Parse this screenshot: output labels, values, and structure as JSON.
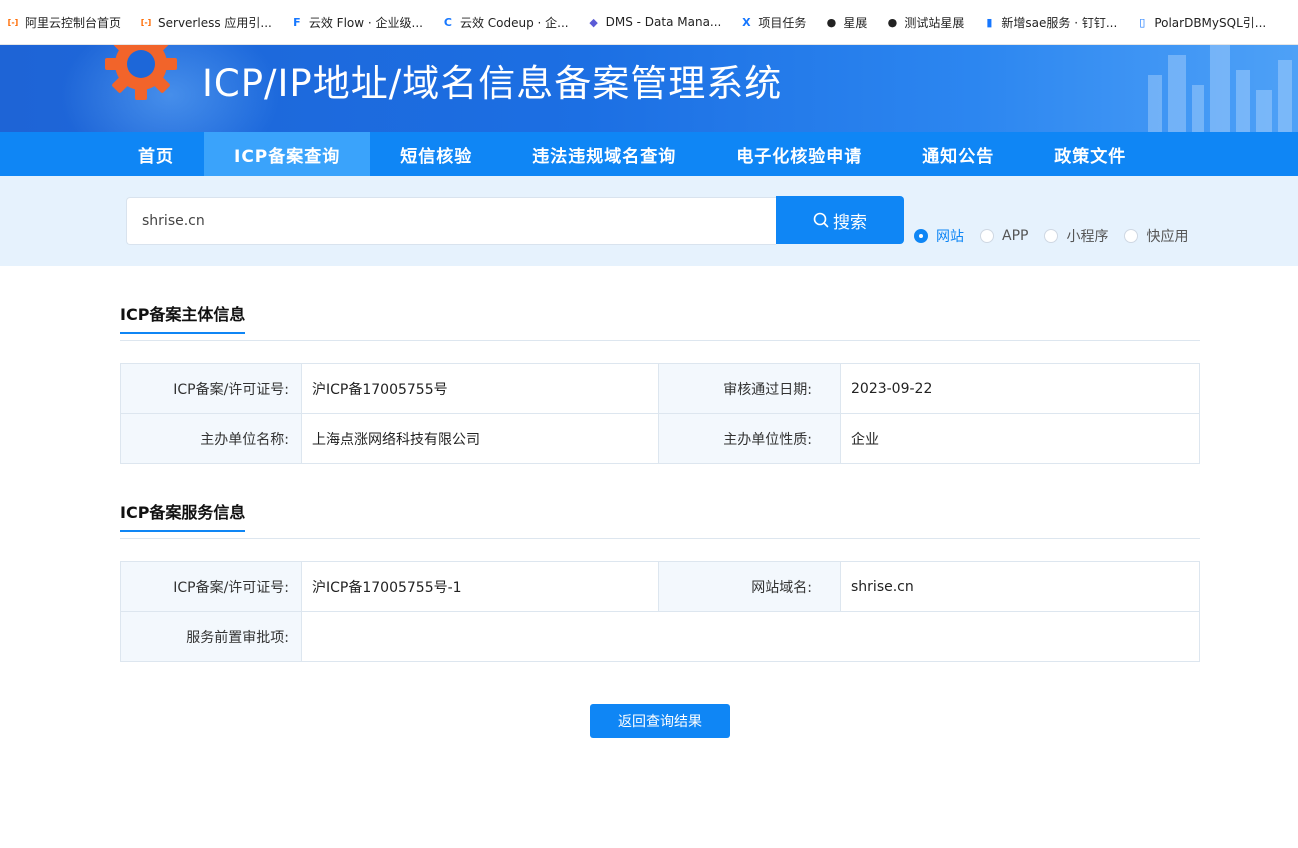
{
  "bookmarks": [
    {
      "label": "阿里云控制台首页",
      "icon": "aliyun-icon",
      "color": "#ff6a00"
    },
    {
      "label": "Serverless 应用引...",
      "icon": "aliyun-icon",
      "color": "#ff6a00"
    },
    {
      "label": "云效 Flow · 企业级...",
      "icon": "flow-icon",
      "color": "#1677ff"
    },
    {
      "label": "云效 Codeup · 企...",
      "icon": "codeup-icon",
      "color": "#1677ff"
    },
    {
      "label": "DMS - Data Mana...",
      "icon": "dms-icon",
      "color": "#5b5bd6"
    },
    {
      "label": "项目任务",
      "icon": "x-icon",
      "color": "#1677ff"
    },
    {
      "label": "星展",
      "icon": "github-icon",
      "color": "#222222"
    },
    {
      "label": "测试站星展",
      "icon": "github-icon",
      "color": "#222222"
    },
    {
      "label": "新增sae服务 · 钉钉...",
      "icon": "doc-icon",
      "color": "#1677ff"
    },
    {
      "label": "PolarDBMySQL引...",
      "icon": "book-icon",
      "color": "#1677ff"
    }
  ],
  "banner": {
    "title": "ICP/IP地址/域名信息备案管理系统"
  },
  "nav": [
    {
      "label": "首页",
      "active": false
    },
    {
      "label": "ICP备案查询",
      "active": true
    },
    {
      "label": "短信核验",
      "active": false
    },
    {
      "label": "违法违规域名查询",
      "active": false
    },
    {
      "label": "电子化核验申请",
      "active": false
    },
    {
      "label": "通知公告",
      "active": false
    },
    {
      "label": "政策文件",
      "active": false
    }
  ],
  "search": {
    "value": "shrise.cn",
    "button_label": "搜索",
    "types": [
      {
        "label": "网站",
        "selected": true
      },
      {
        "label": "APP",
        "selected": false
      },
      {
        "label": "小程序",
        "selected": false
      },
      {
        "label": "快应用",
        "selected": false
      }
    ]
  },
  "subject": {
    "title": "ICP备案主体信息",
    "rows": [
      {
        "k1": "ICP备案/许可证号:",
        "v1": "沪ICP备17005755号",
        "k2": "审核通过日期:",
        "v2": "2023-09-22"
      },
      {
        "k1": "主办单位名称:",
        "v1": "上海点涨网络科技有限公司",
        "k2": "主办单位性质:",
        "v2": "企业"
      }
    ]
  },
  "service": {
    "title": "ICP备案服务信息",
    "row1": {
      "k1": "ICP备案/许可证号:",
      "v1": "沪ICP备17005755号-1",
      "k2": "网站域名:",
      "v2": "shrise.cn"
    },
    "row2": {
      "k1": "服务前置审批项:",
      "v1": ""
    }
  },
  "back_button": "返回查询结果",
  "colors": {
    "primary": "#0f86f5",
    "nav_active": "#3aa3fb",
    "banner": "#1c6fe3"
  }
}
